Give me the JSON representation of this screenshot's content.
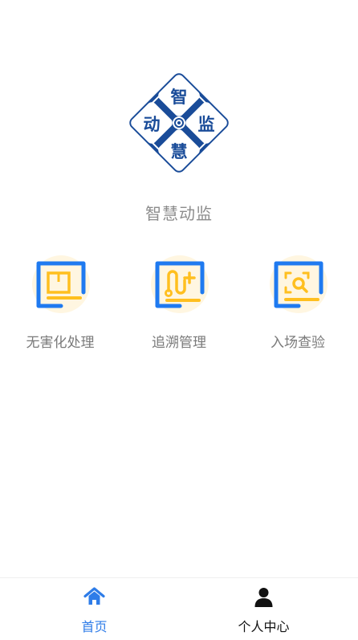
{
  "colors": {
    "brand_blue": "#1a4c99",
    "icon_blue": "#1f7af0",
    "icon_yellow": "#ffbf1f",
    "icon_bg": "#fff6e1",
    "tab_active": "#2e7ce8",
    "tab_inactive": "#111111"
  },
  "logo": {
    "char_top": "智",
    "char_left": "动",
    "char_right": "监",
    "char_bottom": "慧"
  },
  "app": {
    "title": "智慧动监"
  },
  "menu": {
    "items": [
      {
        "label": "无害化处理",
        "icon": "document-box-icon"
      },
      {
        "label": "追溯管理",
        "icon": "trace-route-icon"
      },
      {
        "label": "入场查验",
        "icon": "scan-inspect-icon"
      }
    ]
  },
  "tabbar": {
    "items": [
      {
        "label": "首页",
        "icon": "home-icon",
        "active": true
      },
      {
        "label": "个人中心",
        "icon": "user-icon",
        "active": false
      }
    ]
  }
}
